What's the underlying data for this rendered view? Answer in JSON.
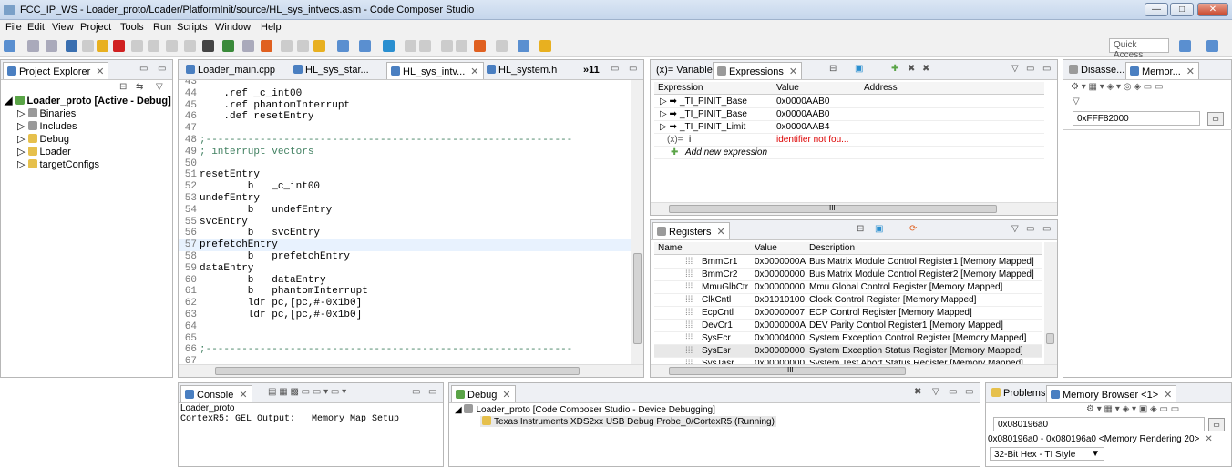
{
  "window": {
    "title": "FCC_IP_WS - Loader_proto/Loader/PlatformInit/source/HL_sys_intvecs.asm - Code Composer Studio",
    "min": "—",
    "max": "□",
    "close": "✕"
  },
  "menu": [
    "File",
    "Edit",
    "View",
    "Project",
    "Tools",
    "Run",
    "Scripts",
    "Window",
    "Help"
  ],
  "quick_access": "Quick Access",
  "project_explorer": {
    "tab": "Project Explorer",
    "items": [
      "Loader_proto  [Active - Debug]",
      "Binaries",
      "Includes",
      "Debug",
      "Loader",
      "targetConfigs"
    ]
  },
  "editor": {
    "tabs": [
      "Loader_main.cpp",
      "HL_sys_star...",
      "HL_sys_intv...",
      "HL_system.h",
      "»11"
    ],
    "lines": [
      {
        "n": "43",
        "t": ""
      },
      {
        "n": "44",
        "t": "    .ref _c_int00"
      },
      {
        "n": "45",
        "t": "    .ref phantomInterrupt"
      },
      {
        "n": "46",
        "t": "    .def resetEntry"
      },
      {
        "n": "47",
        "t": ""
      },
      {
        "n": "48",
        "t": ";-------------------------------------------------------------"
      },
      {
        "n": "49",
        "t": "; interrupt vectors"
      },
      {
        "n": "50",
        "t": ""
      },
      {
        "n": "51",
        "t": "resetEntry"
      },
      {
        "n": "52",
        "t": "        b   _c_int00"
      },
      {
        "n": "53",
        "t": "undefEntry"
      },
      {
        "n": "54",
        "t": "        b   undefEntry"
      },
      {
        "n": "55",
        "t": "svcEntry"
      },
      {
        "n": "56",
        "t": "        b   svcEntry"
      },
      {
        "n": "57",
        "t": "prefetchEntry"
      },
      {
        "n": "58",
        "t": "        b   prefetchEntry"
      },
      {
        "n": "59",
        "t": "dataEntry"
      },
      {
        "n": "60",
        "t": "        b   dataEntry"
      },
      {
        "n": "61",
        "t": "        b   phantomInterrupt"
      },
      {
        "n": "62",
        "t": "        ldr pc,[pc,#-0x1b0]"
      },
      {
        "n": "63",
        "t": "        ldr pc,[pc,#-0x1b0]"
      },
      {
        "n": "64",
        "t": ""
      },
      {
        "n": "65",
        "t": ""
      },
      {
        "n": "66",
        "t": ";-------------------------------------------------------------"
      },
      {
        "n": "67",
        "t": ""
      }
    ]
  },
  "expressions": {
    "tabs": [
      "(x)= Variables",
      "Expressions"
    ],
    "headers": [
      "Expression",
      "Value",
      "Address"
    ],
    "rows": [
      [
        "_TI_PINIT_Base",
        "0x0000AAB0"
      ],
      [
        "_TI_PINIT_Base",
        "0x0000AAB0"
      ],
      [
        "_TI_PINIT_Limit",
        "0x0000AAB4"
      ],
      [
        "i",
        "identifier not fou..."
      ]
    ],
    "add": "Add new expression",
    "hscroll": "III"
  },
  "registers": {
    "tab": "Registers",
    "headers": [
      "Name",
      "Value",
      "Description"
    ],
    "rows": [
      [
        "BmmCr1",
        "0x0000000A",
        "Bus Matrix Module Control Register1 [Memory Mapped]"
      ],
      [
        "BmmCr2",
        "0x00000000",
        "Bus Matrix Module Control Register2 [Memory Mapped]"
      ],
      [
        "MmuGlbCtr",
        "0x00000000",
        "Mmu Global Control Register [Memory Mapped]"
      ],
      [
        "ClkCntl",
        "0x01010100",
        "Clock Control Register [Memory Mapped]"
      ],
      [
        "EcpCntl",
        "0x00000007",
        "ECP Control Register [Memory Mapped]"
      ],
      [
        "DevCr1",
        "0x0000000A",
        "DEV Parity Control Register1 [Memory Mapped]"
      ],
      [
        "SysEcr",
        "0x00004000",
        "System Exception Control Register [Memory Mapped]"
      ],
      [
        "SysEsr",
        "0x00000000",
        "System Exception Status Register [Memory Mapped]"
      ],
      [
        "SysTasr",
        "0x00000000",
        "System Test Abort Status Register [Memory Mapped]"
      ]
    ],
    "hscroll": "III"
  },
  "right_top": {
    "tabs": [
      "Disasse...",
      "Memor..."
    ],
    "address": "0xFFF82000"
  },
  "console": {
    "tab": "Console",
    "project": "Loader_proto",
    "line": "CortexR5: GEL Output:   Memory Map Setup",
    "hscroll": "III"
  },
  "debug": {
    "tab": "Debug",
    "items": [
      "Loader_proto [Code Composer Studio - Device Debugging]",
      "Texas Instruments XDS2xx USB Debug Probe_0/CortexR5 (Running)"
    ]
  },
  "bottom_right": {
    "tabs": [
      "Problems",
      "Memory Browser <1>"
    ],
    "address": "0x080196a0",
    "range": "0x080196a0 - 0x080196a0 <Memory Rendering 20>",
    "format": "32-Bit Hex - TI Style"
  }
}
